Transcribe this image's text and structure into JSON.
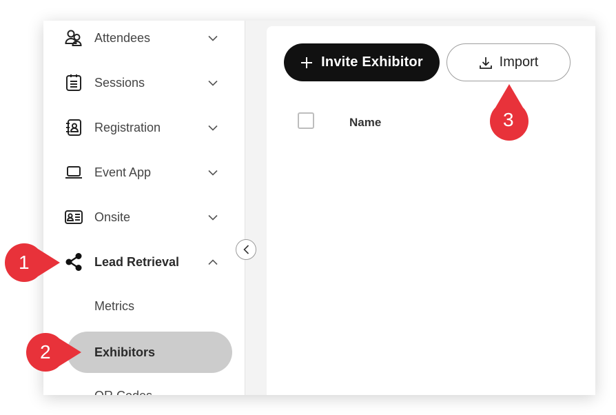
{
  "sidebar": {
    "items": [
      {
        "label": "Attendees",
        "icon": "users-icon"
      },
      {
        "label": "Sessions",
        "icon": "clipboard-icon"
      },
      {
        "label": "Registration",
        "icon": "contact-book-icon"
      },
      {
        "label": "Event App",
        "icon": "laptop-icon"
      },
      {
        "label": "Onsite",
        "icon": "id-card-icon"
      },
      {
        "label": "Lead Retrieval",
        "icon": "share-icon",
        "expanded": true
      }
    ],
    "sub_items": [
      {
        "label": "Metrics"
      },
      {
        "label": "Exhibitors",
        "selected": true
      },
      {
        "label": "QR Codes"
      }
    ]
  },
  "main": {
    "invite_button": "Invite Exhibitor",
    "import_button": "Import",
    "table": {
      "columns": [
        "Name"
      ]
    }
  },
  "markers": [
    {
      "number": "1"
    },
    {
      "number": "2"
    },
    {
      "number": "3"
    }
  ],
  "colors": {
    "marker": "#e8323a",
    "selected_bg": "#cccccc",
    "primary_button": "#111111"
  }
}
